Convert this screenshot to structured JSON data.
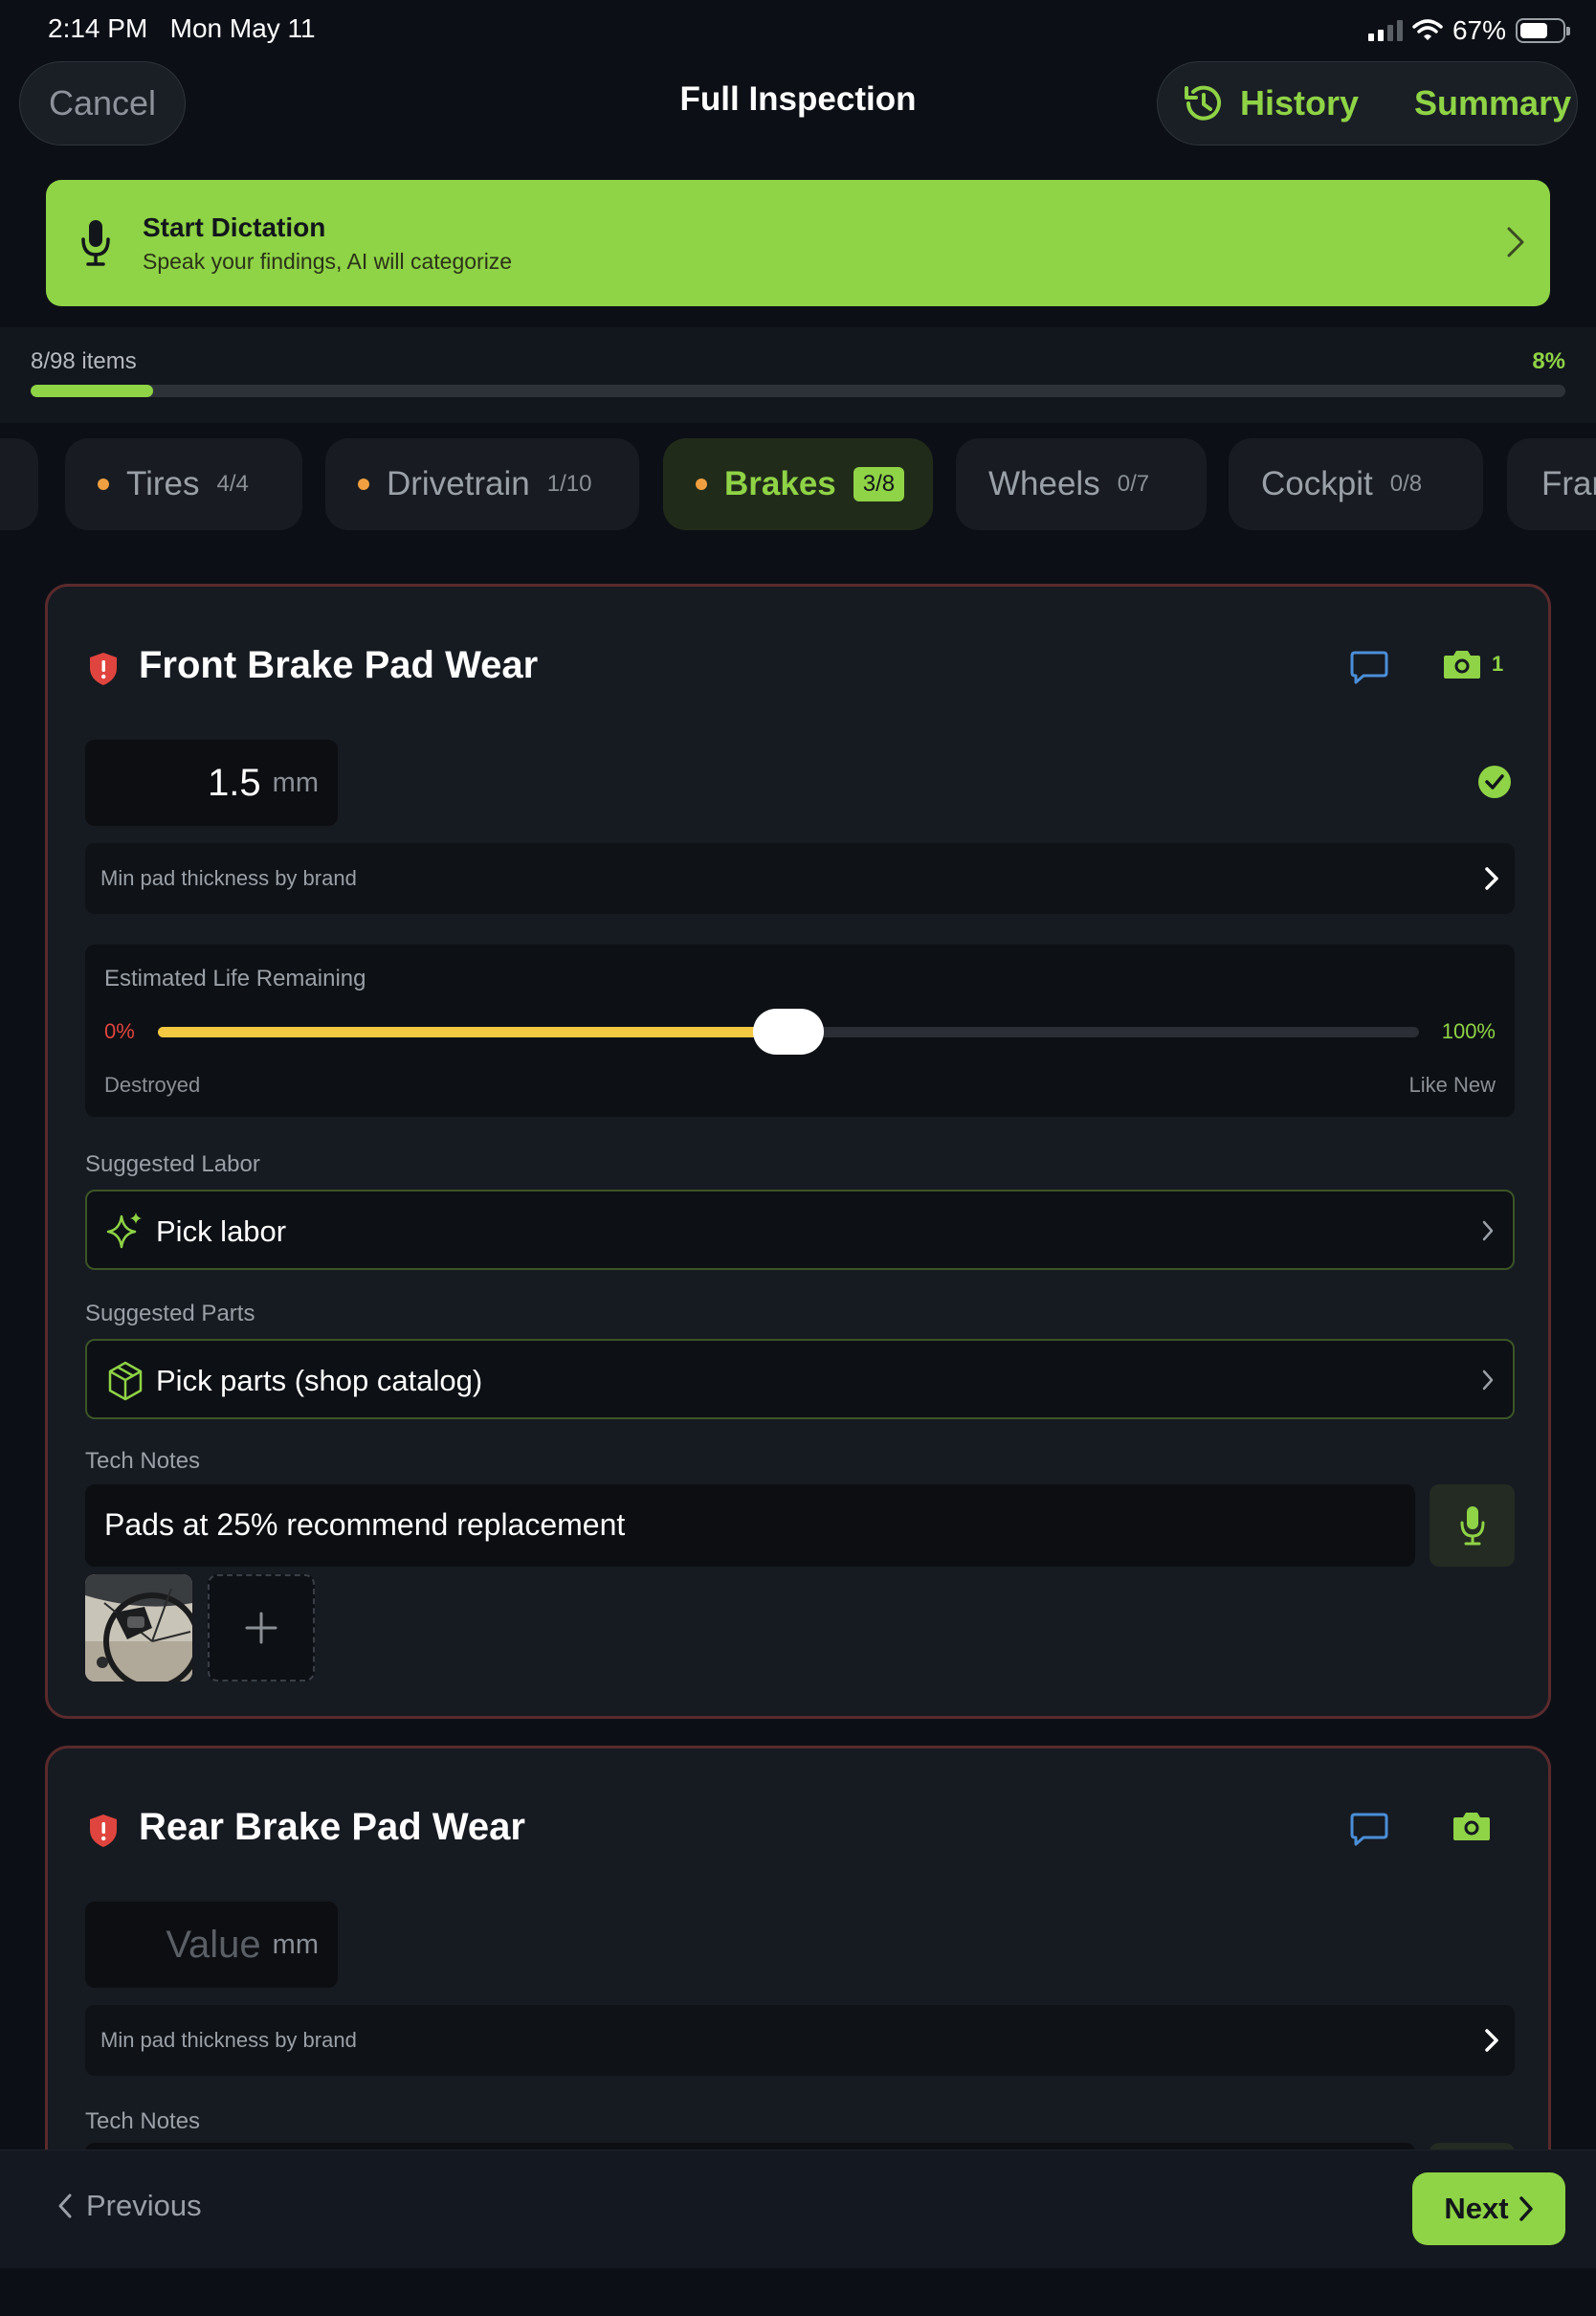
{
  "status_bar": {
    "time": "2:14 PM",
    "date": "Mon May 11",
    "battery": "67%",
    "battery_level": 0.67,
    "signal_icon": "signal-icon",
    "wifi_icon": "wifi-icon"
  },
  "nav": {
    "cancel_label": "Cancel",
    "title": "Full Inspection",
    "history_label": "History",
    "summary_label": "Summary"
  },
  "dictation": {
    "title": "Start Dictation",
    "subtitle": "Speak your findings, AI will categorize"
  },
  "progress": {
    "count_label": "8/98 items",
    "percent_label": "8%",
    "fraction": 0.08
  },
  "tabs": [
    {
      "label": "Tires",
      "count": "4/4",
      "dot": true
    },
    {
      "label": "Drivetrain",
      "count": "1/10",
      "dot": true
    },
    {
      "label": "Brakes",
      "count": "3/8",
      "dot": true,
      "active": true
    },
    {
      "label": "Wheels",
      "count": "0/7",
      "dot": false
    },
    {
      "label": "Cockpit",
      "count": "0/8",
      "dot": false
    },
    {
      "label": "Frar",
      "count": "",
      "dot": false
    }
  ],
  "cards": [
    {
      "title": "Front Brake Pad Wear",
      "photo_count": "1",
      "value": "1.5",
      "unit": "mm",
      "min_thickness_label": "Min pad thickness by brand",
      "life": {
        "title": "Estimated Life Remaining",
        "min_label": "0%",
        "max_label": "100%",
        "left_caption": "Destroyed",
        "right_caption": "Like New",
        "level": 0.5
      },
      "labor": {
        "label": "Suggested Labor",
        "placeholder": "Pick labor"
      },
      "parts": {
        "label": "Suggested Parts",
        "placeholder": "Pick parts (shop catalog)"
      },
      "notes": {
        "label": "Tech Notes",
        "value": "Pads at 25% recommend replacement"
      }
    },
    {
      "title": "Rear Brake Pad Wear",
      "value_placeholder": "Value",
      "unit": "mm",
      "min_thickness_label": "Min pad thickness by brand",
      "notes": {
        "label": "Tech Notes"
      }
    }
  ],
  "bottom": {
    "previous_label": "Previous",
    "next_label": "Next"
  },
  "colors": {
    "accent": "#8fd346",
    "warning": "#f0a040",
    "danger": "#e0443e",
    "slider": "#f5c842",
    "chat": "#4b8fd8"
  }
}
